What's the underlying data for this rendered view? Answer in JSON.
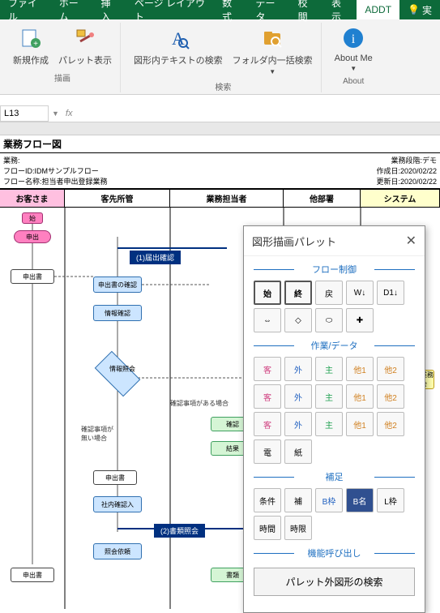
{
  "tabs": {
    "file": "ファイル",
    "home": "ホーム",
    "insert": "挿入",
    "layout": "ページ レイアウト",
    "formula": "数式",
    "data": "データ",
    "review": "校閲",
    "view": "表示",
    "addt": "ADDT",
    "tell": "実"
  },
  "ribbon": {
    "new": "新規作成",
    "palette": "パレット表示",
    "textsearch": "図形内テキストの検索",
    "foldersearch": "フォルダ内一括検索",
    "aboutme": "About Me",
    "grp_draw": "描画",
    "grp_search": "検索",
    "grp_about": "About"
  },
  "fx": {
    "cell": "L13"
  },
  "doc": {
    "title": "業務フロー図",
    "meta_l1": "業務:",
    "meta_l2": "フローID:IDMサンプルフロー",
    "meta_l3": "フロー名称:担当者申出登録業務",
    "meta_r1": "業務段階:デモ",
    "meta_r2": "作成日:2020/02/22",
    "meta_r3": "更新日:2020/02/22"
  },
  "lanes": {
    "l1": "お客さま",
    "l2": "客先所管",
    "l3": "業務担当者",
    "l4": "他部署",
    "l5": "システム"
  },
  "flow": {
    "start": "始",
    "apply": "申出",
    "doc1": "申出書",
    "b1": "(1)届出確認",
    "confirm": "申出書の確認",
    "verify": "情報確認",
    "match": "情報照会",
    "note1": "確認事項がある場合",
    "note2": "確認事項が無い場合",
    "check": "確認",
    "result": "結果",
    "doc2": "申出書",
    "inhouse": "社内確認入",
    "b2": "(2)書類照会",
    "hist": "照会依頼",
    "doc3": "申出書",
    "write": "書類",
    "sys": "契約照会業務詳細照会"
  },
  "palette": {
    "title": "図形描画パレット",
    "s_flow": "フロー制御",
    "s_work": "作業/データ",
    "s_supp": "補足",
    "s_func": "機能呼び出し",
    "start": "始",
    "end": "終",
    "back": "戻",
    "win": "W↓",
    "din": "D1↓",
    "cust": "客",
    "ext": "外",
    "main": "主",
    "o1": "他1",
    "o2": "他2",
    "tel": "電",
    "paper": "紙",
    "cond": "条件",
    "supp": "補",
    "bframe": "B枠",
    "bname": "B名",
    "lframe": "L枠",
    "time": "時間",
    "limit": "時限",
    "searchbtn": "パレット外図形の検索"
  }
}
